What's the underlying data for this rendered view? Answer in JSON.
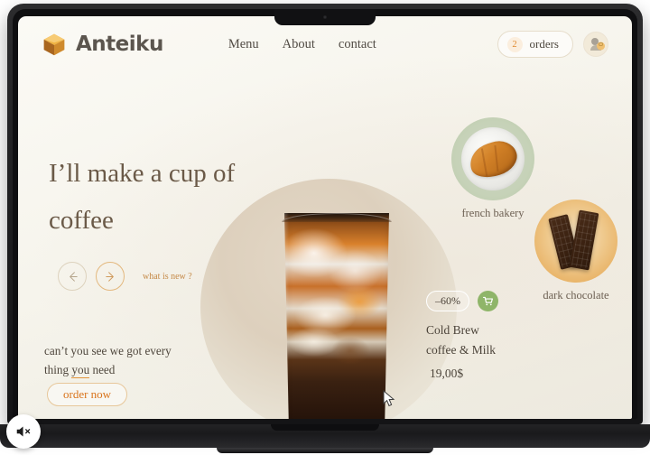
{
  "device": {
    "type": "laptop-mockup",
    "notch": "camera-notch"
  },
  "header": {
    "brand_name": "Anteiku",
    "logo_icon": "cube-icon",
    "nav": [
      {
        "label": "Menu"
      },
      {
        "label": "About"
      },
      {
        "label": "contact"
      }
    ],
    "orders": {
      "count": "2",
      "label": "orders",
      "badge_color": "#e08a2e"
    },
    "avatar_icon": "avatar"
  },
  "hero": {
    "title_line1": "I’ll make a cup of",
    "title_line2": "coffee",
    "prev_icon": "arrow-left-icon",
    "next_icon": "arrow-right-icon",
    "whats_new": "what is new ?",
    "subtext_a": "can’t you see we got every",
    "subtext_b": "thing ",
    "subtext_underline": "you",
    "subtext_c": " need",
    "cta_label": "order now",
    "cta_color": "#d9741c"
  },
  "product": {
    "discount": "–60%",
    "cart_icon": "shopping-cart-icon",
    "cart_color": "#8fb569",
    "name_line1": "Cold Brew",
    "name_line2": "coffee & Milk",
    "price": "19,00$",
    "image": "iced-coffee-glass"
  },
  "side_cards": [
    {
      "id": "bakery",
      "label": "french bakery",
      "image": "croissant-on-plate"
    },
    {
      "id": "chocolate",
      "label": "dark chocolate",
      "image": "chocolate-bars"
    }
  ],
  "overlay": {
    "mute_icon": "speaker-muted-icon",
    "cursor_icon": "mouse-pointer-icon"
  }
}
